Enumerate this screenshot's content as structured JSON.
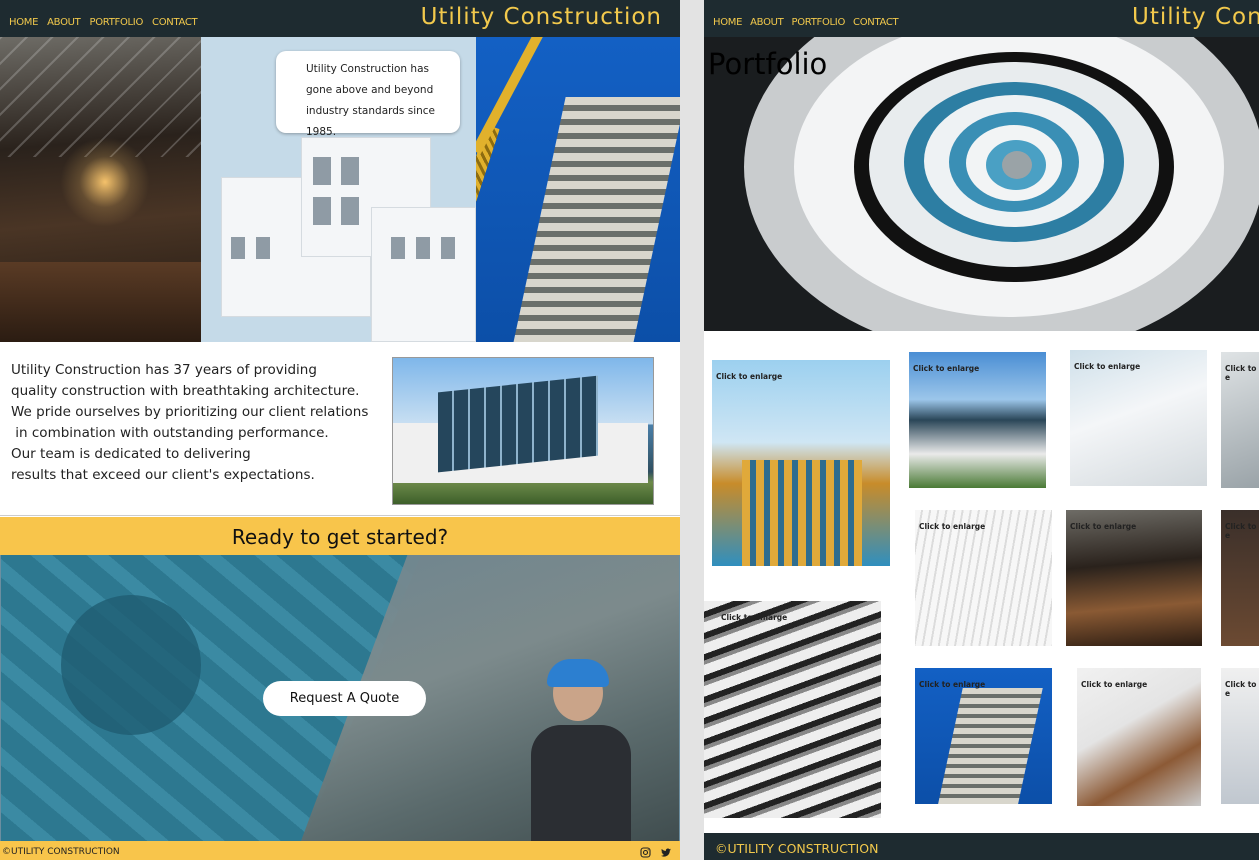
{
  "left_page": {
    "nav": {
      "items": [
        "HOME",
        "ABOUT",
        "PORTFOLIO",
        "CONTACT"
      ],
      "brand": "Utility Construction",
      "text_color": "#f2c94c",
      "bg_color": "#1e2b30"
    },
    "hero_bubble": {
      "lines": [
        "Utility Construction has",
        "gone above and beyond",
        "industry standards since 1985."
      ]
    },
    "about_text": "Utility Construction has 37 years of providing\nquality construction with breathtaking architecture.\nWe pride ourselves by prioritizing our client relations\n in combination with outstanding performance.\nOur team is dedicated to delivering\nresults that exceed our client's expectations.",
    "cta_heading": "Ready to get started?",
    "quote_button": "Request A Quote",
    "footer": {
      "copyright": "©UTILITY CONSTRUCTION",
      "icons": [
        "instagram-icon",
        "twitter-icon"
      ]
    },
    "accent": "#f8c54b"
  },
  "right_page": {
    "nav": {
      "items": [
        "HOME",
        "ABOUT",
        "PORTFOLIO",
        "CONTACT"
      ],
      "brand": "Utility Cons"
    },
    "page_title": "Portfolio",
    "thumb_label": "Click to enlarge",
    "thumb_labels": [
      "Click to enlarge",
      "Click to enlarge",
      "Click to enlarge",
      "Click to e",
      "Click to enlarge",
      "Click to enlarge",
      "Click to e",
      "Click to enlarge",
      "Click to enlarge",
      "Click to enlarge",
      "Click to e"
    ],
    "footer": {
      "copyright": "©UTILITY CONSTRUCTION"
    }
  }
}
